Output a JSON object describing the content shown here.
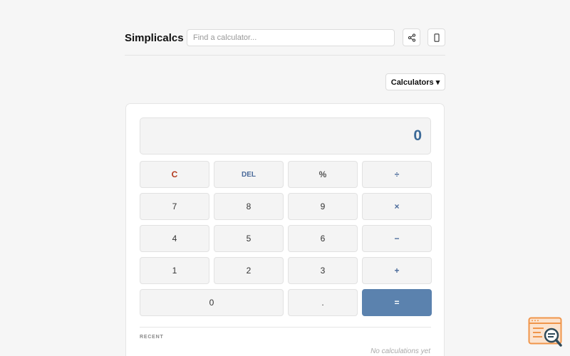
{
  "header": {
    "brand": "Simplicalcs",
    "search_placeholder": "Find a calculator...",
    "share_icon": "share-icon",
    "mobile_icon": "mobile-icon"
  },
  "calculators_button": "Calculators ▾",
  "display": {
    "value": "0"
  },
  "keys": {
    "clear": "C",
    "del": "DEL",
    "percent": "%",
    "divide": "÷",
    "seven": "7",
    "eight": "8",
    "nine": "9",
    "multiply": "×",
    "four": "4",
    "five": "5",
    "six": "6",
    "minus": "−",
    "one": "1",
    "two": "2",
    "three": "3",
    "plus": "+",
    "zero": "0",
    "dot": ".",
    "equals": "="
  },
  "recent": {
    "label": "RECENT",
    "empty_message": "No calculations yet"
  },
  "colors": {
    "accent": "#5b82ae",
    "display_text": "#3c6a98",
    "clear_key": "#b33a1e",
    "background": "#f6f6f6"
  }
}
